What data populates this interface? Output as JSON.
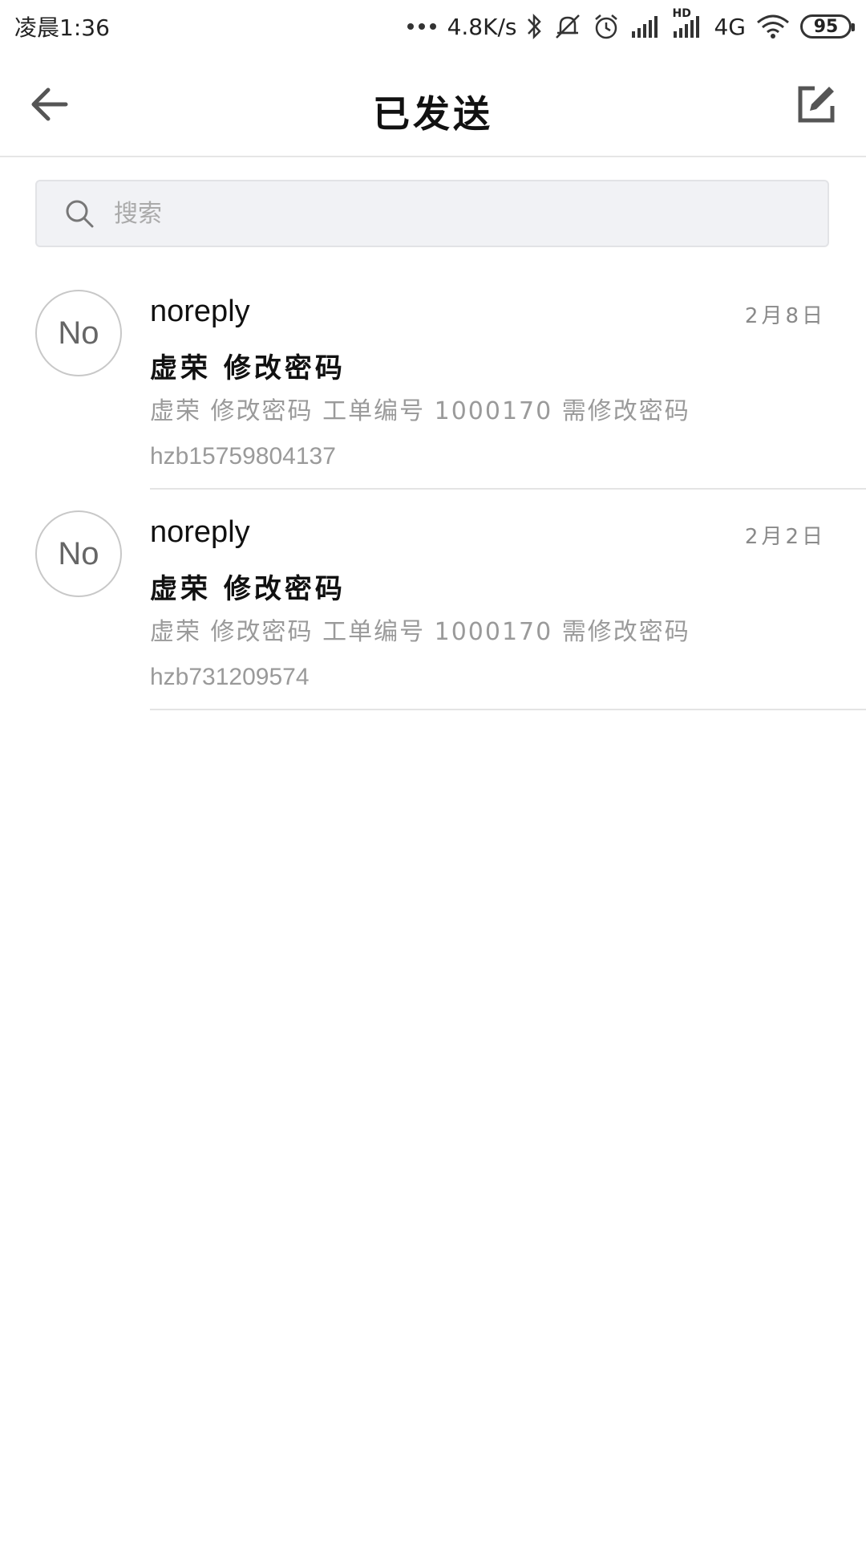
{
  "status_bar": {
    "time": "凌晨1:36",
    "network_speed": "4.8K/s",
    "network_type": "4G",
    "signal_label": "HD",
    "battery": "95",
    "icons": [
      "dots-icon",
      "bluetooth-icon",
      "mute-icon",
      "alarm-icon",
      "signal-icon",
      "hd-signal-icon",
      "wifi-icon",
      "battery-icon"
    ]
  },
  "header": {
    "title": "已发送",
    "back_icon": "arrow-left-icon",
    "compose_icon": "compose-icon"
  },
  "search": {
    "placeholder": "搜索",
    "value": ""
  },
  "mails": [
    {
      "avatar_text": "No",
      "sender": "noreply",
      "date": "2月8日",
      "subject": "虚荣 修改密码",
      "preview_line1": "虚荣 修改密码 工单编号  1000170 需修改密码",
      "preview_line2": "hzb15759804137"
    },
    {
      "avatar_text": "No",
      "sender": "noreply",
      "date": "2月2日",
      "subject": "虚荣 修改密码",
      "preview_line1": "虚荣  修改密码 工单编号  1000170 需修改密码",
      "preview_line2": "hzb731209574"
    }
  ],
  "colors": {
    "background": "#ffffff",
    "search_bg": "#f1f2f5",
    "secondary_text": "#9a9a9a",
    "divider": "#e4e4e4"
  }
}
